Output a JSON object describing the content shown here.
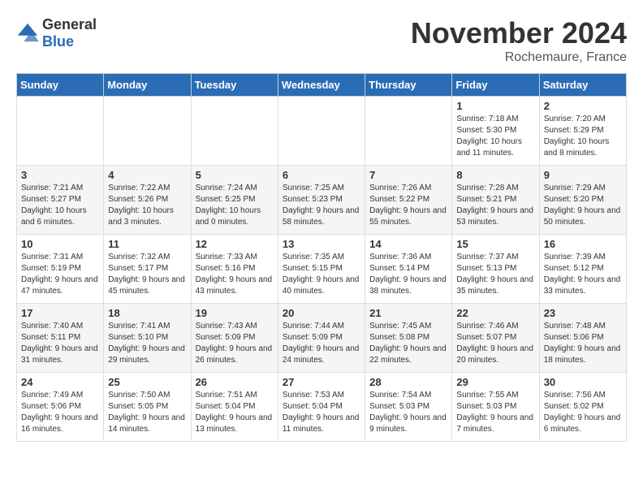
{
  "header": {
    "logo_general": "General",
    "logo_blue": "Blue",
    "title": "November 2024",
    "subtitle": "Rochemaure, France"
  },
  "days_of_week": [
    "Sunday",
    "Monday",
    "Tuesday",
    "Wednesday",
    "Thursday",
    "Friday",
    "Saturday"
  ],
  "weeks": [
    [
      {
        "day": "",
        "info": ""
      },
      {
        "day": "",
        "info": ""
      },
      {
        "day": "",
        "info": ""
      },
      {
        "day": "",
        "info": ""
      },
      {
        "day": "",
        "info": ""
      },
      {
        "day": "1",
        "info": "Sunrise: 7:18 AM\nSunset: 5:30 PM\nDaylight: 10 hours and 11 minutes."
      },
      {
        "day": "2",
        "info": "Sunrise: 7:20 AM\nSunset: 5:29 PM\nDaylight: 10 hours and 8 minutes."
      }
    ],
    [
      {
        "day": "3",
        "info": "Sunrise: 7:21 AM\nSunset: 5:27 PM\nDaylight: 10 hours and 6 minutes."
      },
      {
        "day": "4",
        "info": "Sunrise: 7:22 AM\nSunset: 5:26 PM\nDaylight: 10 hours and 3 minutes."
      },
      {
        "day": "5",
        "info": "Sunrise: 7:24 AM\nSunset: 5:25 PM\nDaylight: 10 hours and 0 minutes."
      },
      {
        "day": "6",
        "info": "Sunrise: 7:25 AM\nSunset: 5:23 PM\nDaylight: 9 hours and 58 minutes."
      },
      {
        "day": "7",
        "info": "Sunrise: 7:26 AM\nSunset: 5:22 PM\nDaylight: 9 hours and 55 minutes."
      },
      {
        "day": "8",
        "info": "Sunrise: 7:28 AM\nSunset: 5:21 PM\nDaylight: 9 hours and 53 minutes."
      },
      {
        "day": "9",
        "info": "Sunrise: 7:29 AM\nSunset: 5:20 PM\nDaylight: 9 hours and 50 minutes."
      }
    ],
    [
      {
        "day": "10",
        "info": "Sunrise: 7:31 AM\nSunset: 5:19 PM\nDaylight: 9 hours and 47 minutes."
      },
      {
        "day": "11",
        "info": "Sunrise: 7:32 AM\nSunset: 5:17 PM\nDaylight: 9 hours and 45 minutes."
      },
      {
        "day": "12",
        "info": "Sunrise: 7:33 AM\nSunset: 5:16 PM\nDaylight: 9 hours and 43 minutes."
      },
      {
        "day": "13",
        "info": "Sunrise: 7:35 AM\nSunset: 5:15 PM\nDaylight: 9 hours and 40 minutes."
      },
      {
        "day": "14",
        "info": "Sunrise: 7:36 AM\nSunset: 5:14 PM\nDaylight: 9 hours and 38 minutes."
      },
      {
        "day": "15",
        "info": "Sunrise: 7:37 AM\nSunset: 5:13 PM\nDaylight: 9 hours and 35 minutes."
      },
      {
        "day": "16",
        "info": "Sunrise: 7:39 AM\nSunset: 5:12 PM\nDaylight: 9 hours and 33 minutes."
      }
    ],
    [
      {
        "day": "17",
        "info": "Sunrise: 7:40 AM\nSunset: 5:11 PM\nDaylight: 9 hours and 31 minutes."
      },
      {
        "day": "18",
        "info": "Sunrise: 7:41 AM\nSunset: 5:10 PM\nDaylight: 9 hours and 29 minutes."
      },
      {
        "day": "19",
        "info": "Sunrise: 7:43 AM\nSunset: 5:09 PM\nDaylight: 9 hours and 26 minutes."
      },
      {
        "day": "20",
        "info": "Sunrise: 7:44 AM\nSunset: 5:09 PM\nDaylight: 9 hours and 24 minutes."
      },
      {
        "day": "21",
        "info": "Sunrise: 7:45 AM\nSunset: 5:08 PM\nDaylight: 9 hours and 22 minutes."
      },
      {
        "day": "22",
        "info": "Sunrise: 7:46 AM\nSunset: 5:07 PM\nDaylight: 9 hours and 20 minutes."
      },
      {
        "day": "23",
        "info": "Sunrise: 7:48 AM\nSunset: 5:06 PM\nDaylight: 9 hours and 18 minutes."
      }
    ],
    [
      {
        "day": "24",
        "info": "Sunrise: 7:49 AM\nSunset: 5:06 PM\nDaylight: 9 hours and 16 minutes."
      },
      {
        "day": "25",
        "info": "Sunrise: 7:50 AM\nSunset: 5:05 PM\nDaylight: 9 hours and 14 minutes."
      },
      {
        "day": "26",
        "info": "Sunrise: 7:51 AM\nSunset: 5:04 PM\nDaylight: 9 hours and 13 minutes."
      },
      {
        "day": "27",
        "info": "Sunrise: 7:53 AM\nSunset: 5:04 PM\nDaylight: 9 hours and 11 minutes."
      },
      {
        "day": "28",
        "info": "Sunrise: 7:54 AM\nSunset: 5:03 PM\nDaylight: 9 hours and 9 minutes."
      },
      {
        "day": "29",
        "info": "Sunrise: 7:55 AM\nSunset: 5:03 PM\nDaylight: 9 hours and 7 minutes."
      },
      {
        "day": "30",
        "info": "Sunrise: 7:56 AM\nSunset: 5:02 PM\nDaylight: 9 hours and 6 minutes."
      }
    ]
  ]
}
